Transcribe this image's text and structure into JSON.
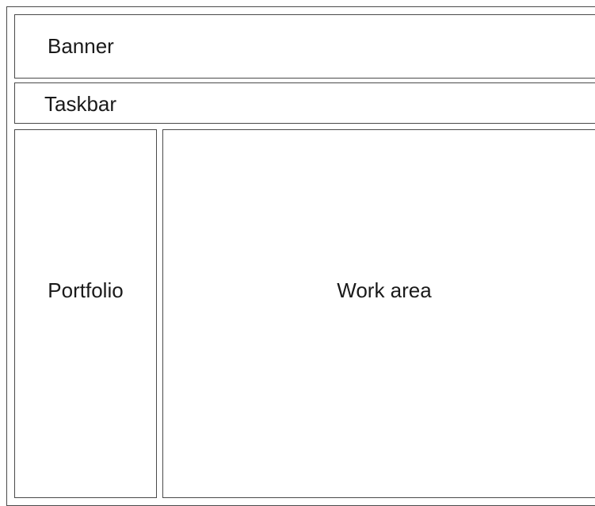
{
  "diagram": {
    "banner": {
      "label": "Banner"
    },
    "taskbar": {
      "label": "Taskbar"
    },
    "portfolio": {
      "label": "Portfolio"
    },
    "work_area": {
      "label": "Work area"
    }
  }
}
